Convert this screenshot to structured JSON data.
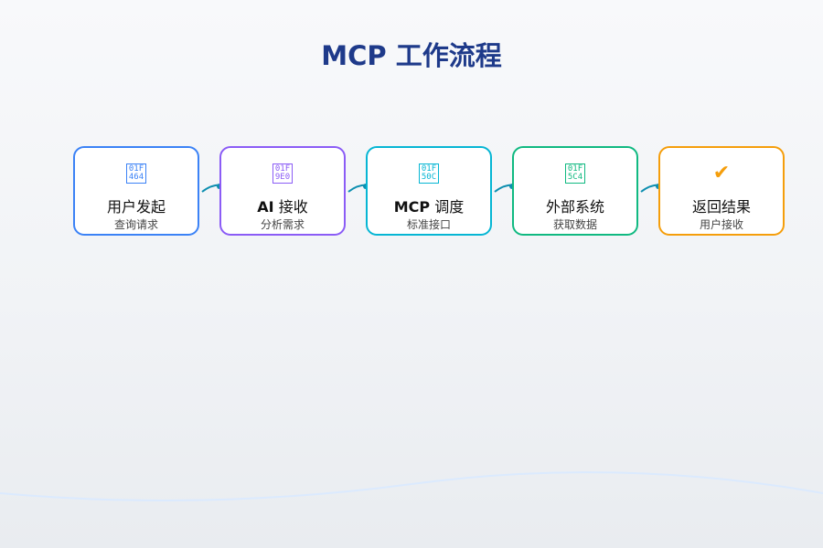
{
  "title": "MCP 工作流程",
  "steps": [
    {
      "bold": "",
      "label": "用户发起",
      "sub": "查询请求",
      "icon": "user-icon",
      "icon_hex": [
        "01F",
        "464"
      ],
      "color": "#3b82f6"
    },
    {
      "bold": "AI",
      "label": " 接收",
      "sub": "分析需求",
      "icon": "robot-icon",
      "icon_hex": [
        "01F",
        "9E0"
      ],
      "color": "#8b5cf6"
    },
    {
      "bold": "MCP",
      "label": " 调度",
      "sub": "标准接口",
      "icon": "plug-icon",
      "icon_hex": [
        "01F",
        "50C"
      ],
      "color": "#06b6d4"
    },
    {
      "bold": "",
      "label": "外部系统",
      "sub": "获取数据",
      "icon": "data-chart-icon",
      "icon_hex": [
        "01F",
        "5C4"
      ],
      "color": "#10b981"
    },
    {
      "bold": "",
      "label": "返回结果",
      "sub": "用户接收",
      "icon": "check-mark-icon",
      "icon_glyph": "✔",
      "color": "#f59e0b"
    }
  ],
  "colors": {
    "title": "#1e3a8a",
    "connector": "#0e8fb0",
    "wave": "#dbeafe"
  }
}
